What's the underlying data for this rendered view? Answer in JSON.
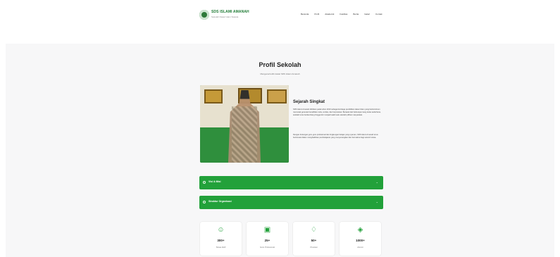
{
  "header": {
    "brand": "SDS ISLAMI AMANAH",
    "brand_sub": "Sekolah Dasar Islam Swasta",
    "nav": [
      "Beranda",
      "Profil",
      "Akademik",
      "Fasilitas",
      "Berita",
      "Galeri",
      "Kontak"
    ]
  },
  "page": {
    "title": "Profil Sekolah",
    "subtitle": "Mengenal lebih dekat SDS Islami Amanah"
  },
  "history": {
    "title": "Sejarah Singkat",
    "paragraphs": [
      "SDS Islami Amanah didirikan pada tahun 2010 sebagai lembaga pendidikan dasar Islam yang berkomitmen mencetak generasi berakhlak mulia, cerdas, dan berprestasi. Berawal dari beberapa ruang kelas sederhana, sekolah terus berkembang hingga kini menjadi salah satu sekolah pilihan masyarakat.",
      "Dengan dukungan guru-guru profesional dan lingkungan belajar yang nyaman, SDS Islami Amanah terus berinovasi dalam menghadirkan pembelajaran yang menyenangkan dan bermakna bagi seluruh siswa."
    ]
  },
  "accordions": [
    {
      "label": "Visi & Misi"
    },
    {
      "label": "Struktur Organisasi"
    }
  ],
  "stats": [
    {
      "icon": "user-icon",
      "value": "300+",
      "label": "Siswa Aktif"
    },
    {
      "icon": "monitor-icon",
      "value": "25+",
      "label": "Guru Profesional"
    },
    {
      "icon": "trophy-icon",
      "value": "50+",
      "label": "Prestasi"
    },
    {
      "icon": "graduation-cap-icon",
      "value": "1000+",
      "label": "Alumni"
    }
  ],
  "colors": {
    "primary": "#22a13a",
    "background": "#f7f7f8"
  }
}
